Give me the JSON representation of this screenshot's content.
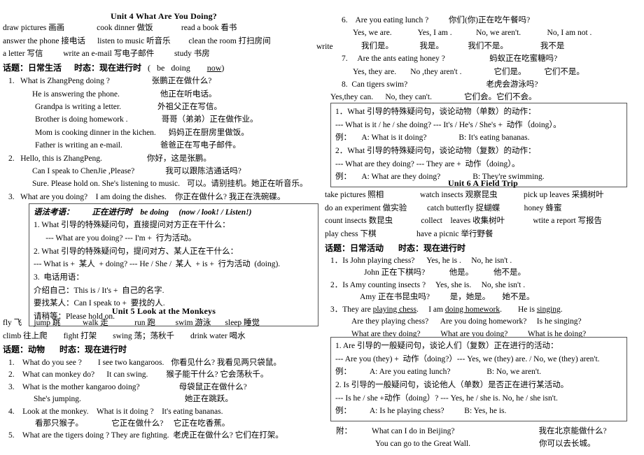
{
  "document": {
    "type": "study-notes",
    "language": "en-zh"
  },
  "unit4": {
    "title": "Unit 4 What Are You Doing?",
    "vocab_rows": [
      "draw pictures 画画                cook dinner 做饭              read a book 看书",
      "answer the phone 接电话      listen to music 听音乐         clean the room 打扫房间",
      "a letter 写信          write an e-mail 写电子邮件          study 书房"
    ],
    "stray_word": "write",
    "topic_label": "话题：日常生活",
    "tense_label": "时态：现在进行时",
    "tense_formula_open": "(   be   doing",
    "tense_formula_now": "now",
    "tense_formula_close": ")",
    "lines": [
      {
        "en": "1.   What is ZhangPeng doing ?",
        "zh": "张鹏正在做什么?",
        "indent": 8,
        "zhcol": 230
      },
      {
        "en": "He is answering the phone.",
        "zh": "他正在听电话。",
        "indent": 42,
        "zhcol": 236
      },
      {
        "en": "Grandpa is writing a letter.",
        "zh": "外祖父正在写信。",
        "indent": 46,
        "zhcol": 228
      },
      {
        "en": "Brother is doing homework .",
        "zh": "哥哥（弟弟）正在做作业。",
        "indent": 46,
        "zhcol": 222
      },
      {
        "en": "Mom is cooking dinner in the kichen.",
        "zh": "妈妈正在厨房里做饭。",
        "indent": 46,
        "zhcol": 226
      },
      {
        "en": "Father is writing an e-mail.",
        "zh": "爸爸正在写电子邮件。",
        "indent": 46,
        "zhcol": 226
      },
      {
        "en": "2.   Hello, this is ZhangPeng.",
        "zh": "你好，这是张鹏。",
        "indent": 8,
        "zhcol": 240
      },
      {
        "en": "Can I speak to ChenJie ,Please?",
        "zh": "我可以跟陈洁通话吗?",
        "indent": 42,
        "zhcol": 228
      },
      {
        "en": "Sure. Please hold on. She's listening to music.",
        "zh": "可以。请别挂机。她正在听音乐。",
        "indent": 42,
        "zhcol": 252
      },
      {
        "en": "3.   What are you doing?    I am doing the dishes.",
        "zh": "你正在做什么? 我正在洗碗碟。",
        "indent": 8,
        "zhcol": 250
      }
    ],
    "grammar_box": {
      "head_title": "语法考语：",
      "head_tense": "正在进行时",
      "head_form": "be doing",
      "head_signal": "(now / look! / Listen!)",
      "lines": [
        "1. What 引导的特殊疑问句，直接提问对方正在干什么：",
        "      --- What are you doing? --- I'm +  行为活动。",
        "2. What 引导的特殊疑问句，提问对方、某人正在干什么：",
        "--- What is +  某人  + doing? --- He / She /  某人  + is +  行为活动  (doing).",
        "3.  电话用语：",
        "介绍自己：This is / It's +  自己的名字.",
        "要找某人：Can I speak to +  要找的人.",
        "请稍等：Please hold on."
      ]
    }
  },
  "unit5": {
    "title": "Unit 5    Look at the Monkeys",
    "vocab_rows": [
      "fly 飞      jump 跳           walk 走             run 跑          swim 游泳       sleep 睡觉",
      "climb 往上爬        fight 打架        swing 荡；荡秋千        drink water 喝水"
    ],
    "topic_label": "话题：动物",
    "tense_label": "时态：现在进行时",
    "lines": [
      {
        "en": "1.    What do you see ?        I see two kangaroos.",
        "zh": "你看见什么? 我看见两只袋鼠。",
        "indent": 8,
        "zhcol": 262
      },
      {
        "en": "2.    What can monkey do?      It can swing.",
        "zh": "猴子能干什么? 它会荡秋千。",
        "indent": 8,
        "zhcol": 262
      },
      {
        "en": "3.    What is the mother kangaroo doing?",
        "zh": "母袋鼠正在做什么?",
        "indent": 8,
        "zhcol": 275
      },
      {
        "en": "She's jumping.",
        "zh": "她正在跳跃。",
        "indent": 44,
        "zhcol": 272
      },
      {
        "en": "4.    Look at the monkey.    What is it doing ?    It's eating bananas.",
        "zh": "",
        "indent": 8,
        "zhcol": 0
      },
      {
        "en": "看那只猴子。              它正在做什么?     它正在吃香蕉。",
        "zh": "",
        "indent": 46,
        "zhcol": 0
      },
      {
        "en": "5.    What are the tigers doing ? They are fighting.  老虎正在做什么? 它们在打架。",
        "zh": "",
        "indent": 8,
        "zhcol": 0
      }
    ]
  },
  "unit4_continued": {
    "lines": [
      {
        "en": "6.    Are you eating lunch ?          你们(你)正在吃午餐吗?",
        "indent": 24
      },
      {
        "en": "Yes, we are.             Yes, I am .            No, we aren't.             No, I am not .",
        "indent": 40
      },
      {
        "en": "我们是。             我是。            我们不是。                我不是",
        "indent": 52
      },
      {
        "en": "7.     Are the ants eating honey ?                      蚂蚁正在吃蜜糖吗?",
        "indent": 24
      },
      {
        "en": "Yes, they are.       No ,they aren't .                它们是。         它们不是。",
        "indent": 40
      },
      {
        "en": "8.  Can tigers swim?                                       老虎会游泳吗?",
        "indent": 24
      },
      {
        "en": "Yes,they can.      No, they can't.                它们会。它们不会。",
        "indent": 22
      }
    ]
  },
  "unit5_grammar_box": {
    "lines": [
      "1．What 引导的特殊疑问句，谈论动物（单数）的动作：",
      "--- What is it / he / she doing? --- It's / He's / She's +  动作（doing）。",
      "例：     A: What is it doing?                B: It's eating bananas.",
      "2．What 引导的特殊疑问句，谈论动物（复数）的动作：",
      "--- What are they doing? --- They are +  动作（doing）。",
      "例：     A: What are they doing?                B: They're swimming."
    ]
  },
  "unit6": {
    "title": "Unit 6 A Field Trip",
    "vocab_rows": [
      "take pictures 照相                  watch insects 观察昆虫             pick up leaves 采摘树叶",
      "do an experiment 做实验          catch butterfly 捉蝴蝶            honey 蜂蜜",
      "count insects 数昆虫              collect    leaves 收集树叶              wtite a report 写报告",
      "play chess 下棋                    have a picnic 举行野餐"
    ],
    "topic_label": "话题：日常活动",
    "tense_label": "时态：现在进行时",
    "lines": [
      {
        "en": "1．Is John playing chess?      Yes, he is .     No, he isn't .",
        "indent": 24
      },
      {
        "en": "John 正在下棋吗?            他是。          他不是。",
        "indent": 60
      },
      {
        "en": "2．Is Amy counting insects ?     Yes, she is.     No, she isn't .",
        "indent": 24
      },
      {
        "en": "Amy 正在书昆虫吗?          是，她是。      她不是。",
        "indent": 56
      },
      {
        "en": "3．They are playing chess.     I am doing homework.     He is singing.",
        "indent": 24,
        "underline": true
      },
      {
        "en": "Are they playing chess?      Are you doing homework?     Is he singing?",
        "indent": 44
      },
      {
        "en": "What are they doing?          What are you doing?          What is he doing?",
        "indent": 44
      }
    ]
  },
  "unit6_grammar_box": {
    "lines": [
      "1. Are 引导的一般疑问句，谈论人们（复数）正在进行的活动：",
      "--- Are you (they) +  动作（doing?）--- Yes, we (they) are. / No, we (they) aren't.",
      "例：         A: Are you eating lunch?                  B: No, we aren't.",
      "2. Is 引导的一般疑问句，谈论他人（单数）是否正在进行某活动。",
      "--- Is he / she +动作（doing）? --- Yes, he / she is. No, he / she isn't.",
      "例：         A: Is he playing chess?          B: Yes, he is."
    ]
  },
  "appendix": {
    "label": "附：",
    "line1_en": "What can I do in Beijing?",
    "line1_zh": "我在北京能做什么?",
    "line2_en": "You can go to the Great Wall.",
    "line2_zh": "你可以去长城。"
  }
}
